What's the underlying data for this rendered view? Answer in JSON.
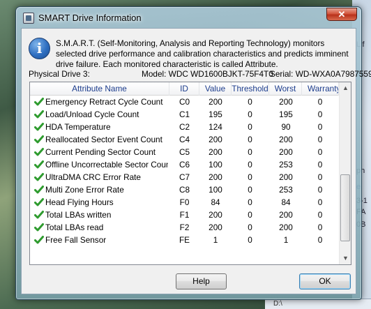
{
  "window": {
    "title": "SMART Drive Information",
    "close_label": "✕"
  },
  "description": "S.M.A.R.T. (Self-Monitoring, Analysis and Reporting Technology) monitors selected drive performance and calibration characteristics and predicts imminent drive failure. Each monitored characteristic is called Attribute.",
  "drive": {
    "label": "Physical Drive 3:",
    "model": "Model: WDC WD1600BJKT-75F4T0",
    "serial": "Serial: WD-WXA0A7987559"
  },
  "table": {
    "columns": [
      "Attribute Name",
      "ID",
      "Value",
      "Threshold",
      "Worst",
      "Warranty"
    ],
    "rows": [
      {
        "name": "Emergency Retract Cycle Count",
        "id": "C0",
        "value": "200",
        "threshold": "0",
        "worst": "200",
        "warranty": "0"
      },
      {
        "name": "Load/Unload Cycle Count",
        "id": "C1",
        "value": "195",
        "threshold": "0",
        "worst": "195",
        "warranty": "0"
      },
      {
        "name": "HDA Temperature",
        "id": "C2",
        "value": "124",
        "threshold": "0",
        "worst": "90",
        "warranty": "0"
      },
      {
        "name": "Reallocated Sector Event Count",
        "id": "C4",
        "value": "200",
        "threshold": "0",
        "worst": "200",
        "warranty": "0"
      },
      {
        "name": "Current Pending Sector Count",
        "id": "C5",
        "value": "200",
        "threshold": "0",
        "worst": "200",
        "warranty": "0"
      },
      {
        "name": "Offline Uncorrectable Sector Count",
        "id": "C6",
        "value": "100",
        "threshold": "0",
        "worst": "253",
        "warranty": "0"
      },
      {
        "name": "UltraDMA CRC Error Rate",
        "id": "C7",
        "value": "200",
        "threshold": "0",
        "worst": "200",
        "warranty": "0"
      },
      {
        "name": "Multi Zone Error Rate",
        "id": "C8",
        "value": "100",
        "threshold": "0",
        "worst": "253",
        "warranty": "0"
      },
      {
        "name": "Head Flying Hours",
        "id": "F0",
        "value": "84",
        "threshold": "0",
        "worst": "84",
        "warranty": "0"
      },
      {
        "name": "Total LBAs written",
        "id": "F1",
        "value": "200",
        "threshold": "0",
        "worst": "200",
        "warranty": "0"
      },
      {
        "name": "Total LBAs read",
        "id": "F2",
        "value": "200",
        "threshold": "0",
        "worst": "200",
        "warranty": "0"
      },
      {
        "name": "Free Fall Sensor",
        "id": "FE",
        "value": "1",
        "threshold": "0",
        "worst": "1",
        "warranty": "0"
      }
    ]
  },
  "buttons": {
    "help": "Help",
    "ok": "OK"
  },
  "background": {
    "fragments": [
      "Lif",
      "ph",
      "el",
      "3-1",
      "FA",
      "0B"
    ],
    "bottom_text": "D:\\"
  },
  "colors": {
    "header_text": "#1c3c8c",
    "check_green": "#2e9b2e",
    "ok_border": "#3c7fb1"
  }
}
